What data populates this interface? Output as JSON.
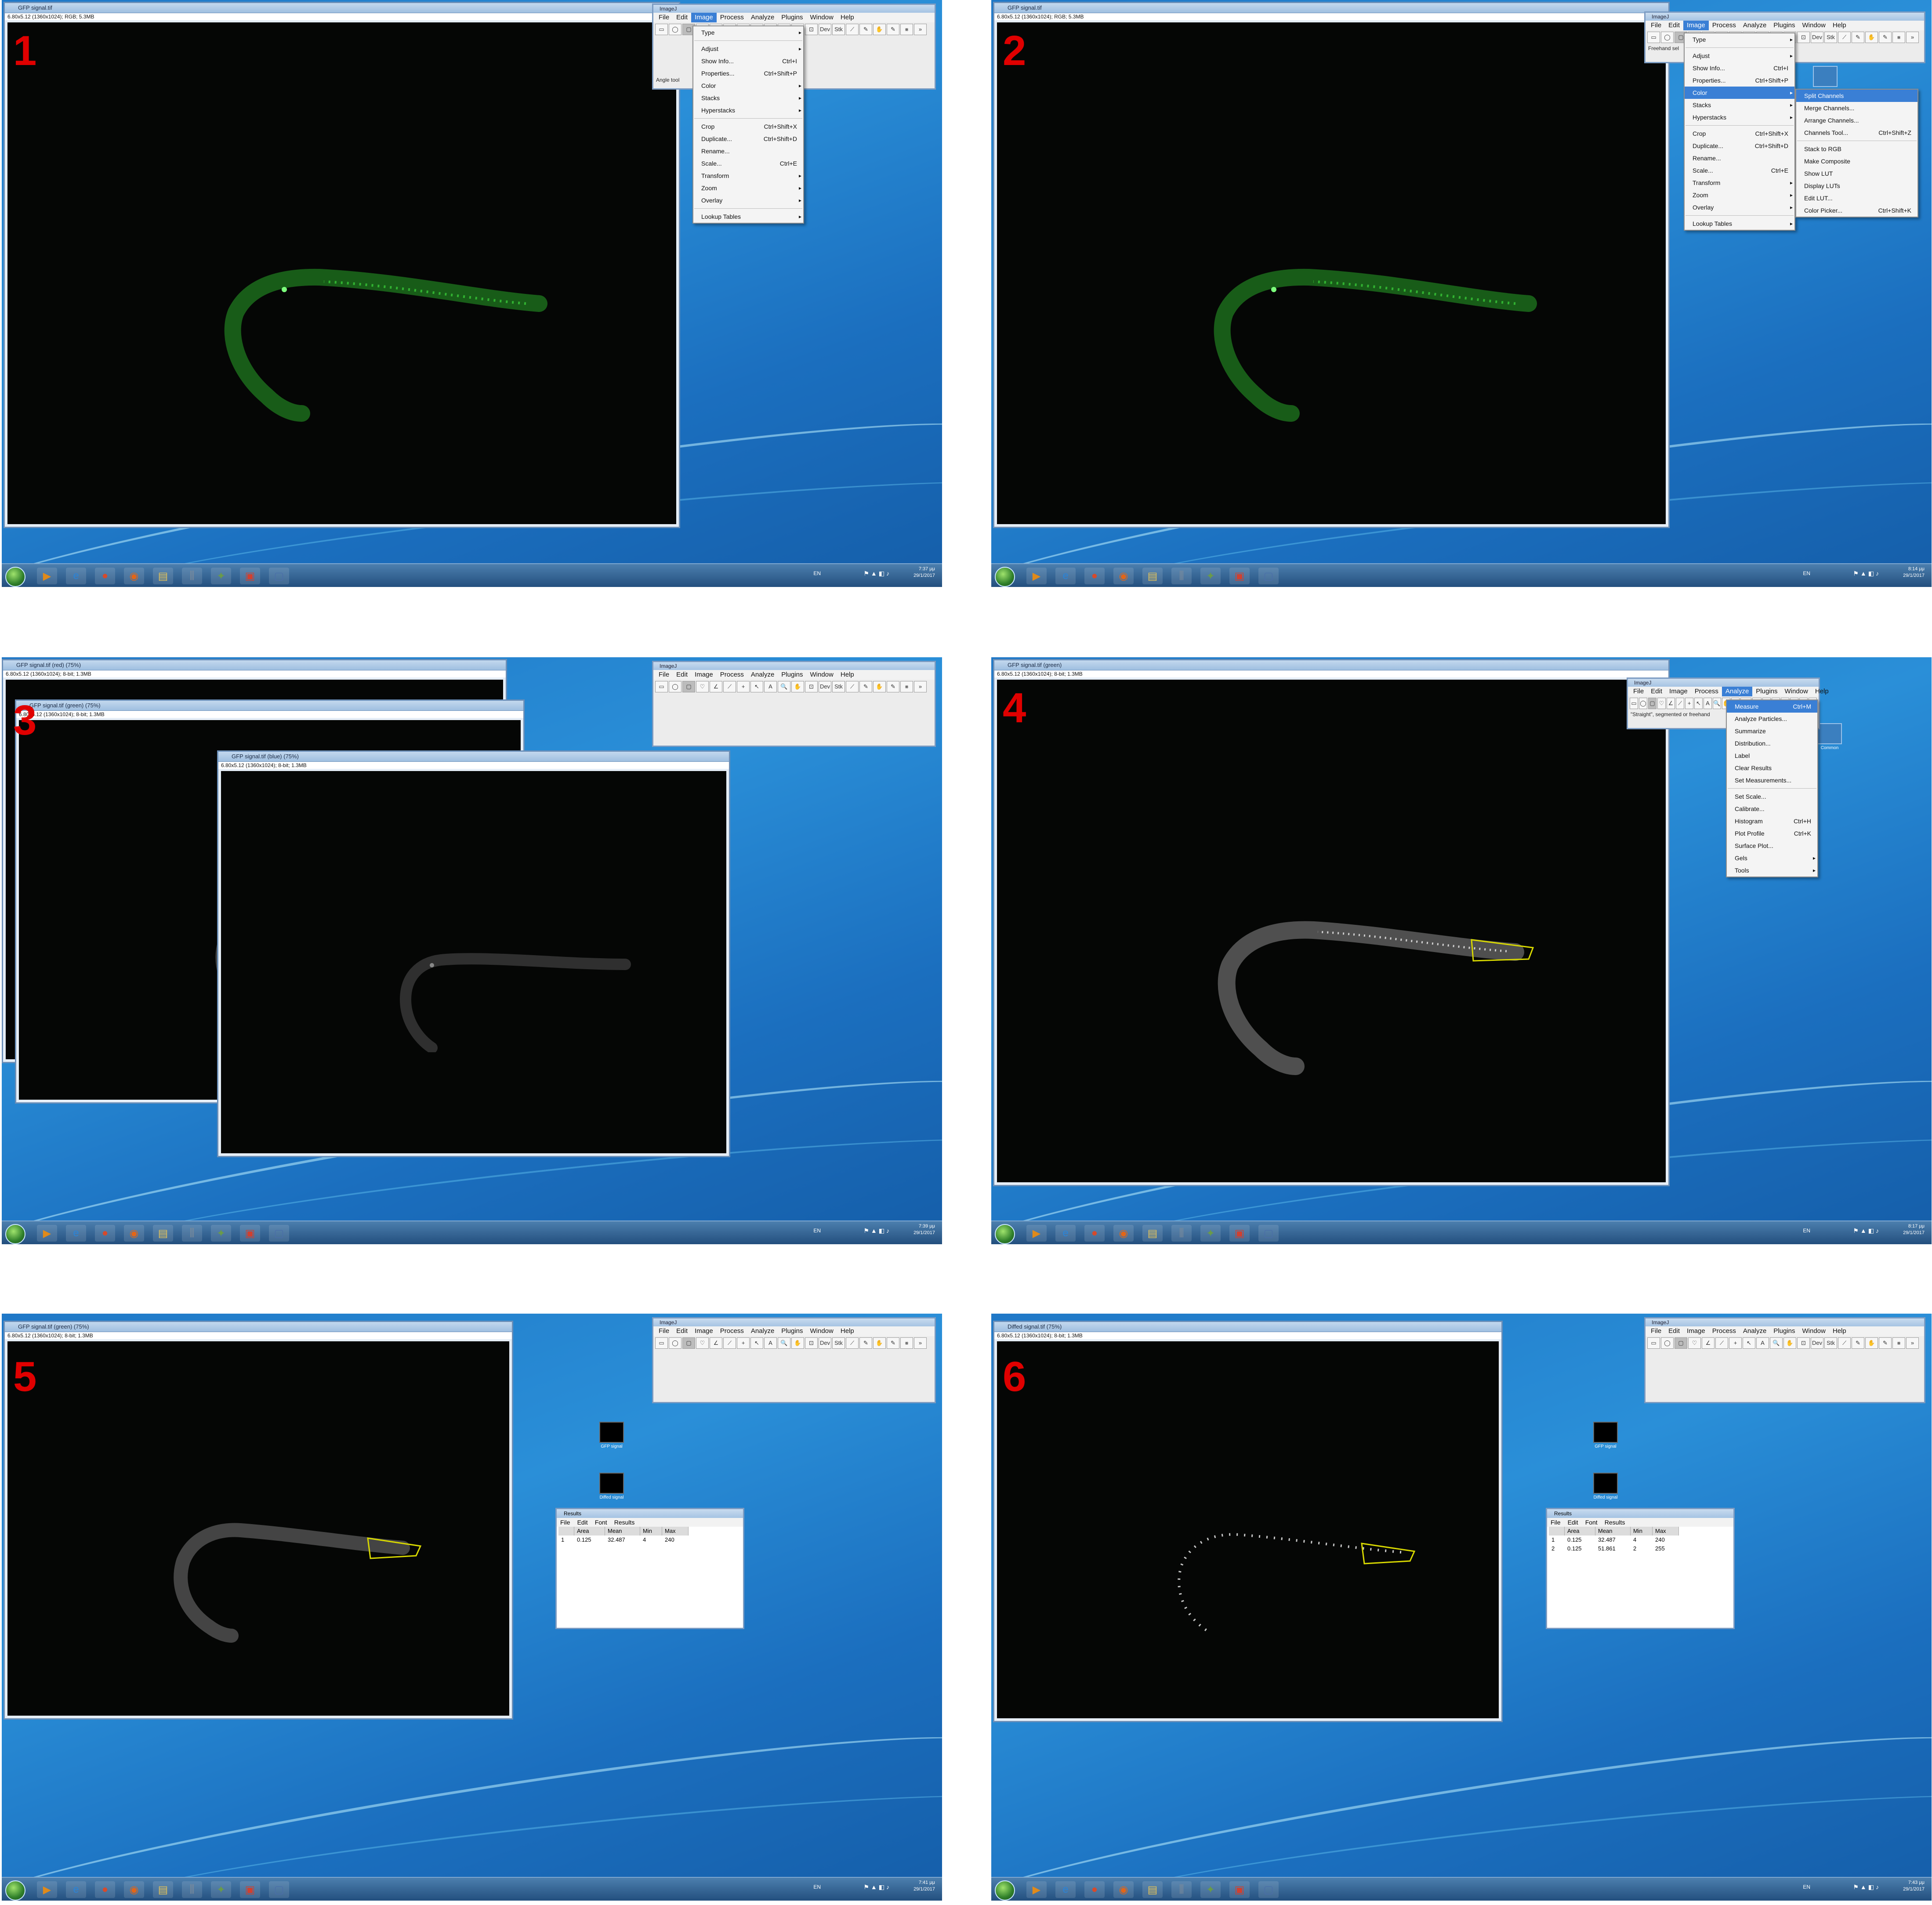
{
  "panels": [
    {
      "number": "1",
      "image_title": "GFP signal.tif",
      "image_info": "6.80x5.12  (1360x1024); RGB; 5.3MB",
      "imagej_title": "ImageJ",
      "imagej_status": "Angle tool",
      "tray_time": "7:37 μμ",
      "tray_date": "29/1/2017"
    },
    {
      "number": "2",
      "image_title": "GFP signal.tif",
      "image_info": "6.80x5.12  (1360x1024); RGB; 5.3MB",
      "imagej_title": "ImageJ",
      "imagej_status": "Freehand sel",
      "tray_time": "8:14 μμ",
      "tray_date": "29/1/2017",
      "desktop_icon": "Common"
    },
    {
      "number": "3",
      "image_title_red": "GFP signal.tif (red) (75%)",
      "image_title_green": "GFP signal.tif (green) (75%)",
      "image_title_blue": "GFP signal.tif (blue) (75%)",
      "image_info": "6.80x5.12  (1360x1024); 8-bit; 1.3MB",
      "imagej_title": "ImageJ",
      "tray_time": "7:39 μμ",
      "tray_date": "29/1/2017"
    },
    {
      "number": "4",
      "image_title": "GFP signal.tif (green)",
      "image_info": "6.80x5.12  (1360x1024); 8-bit; 1.3MB",
      "imagej_title": "ImageJ",
      "imagej_status": "\"Straight\", segmented or freehand",
      "tray_time": "8:17 μμ",
      "tray_date": "29/1/2017",
      "desktop_icon": "Common"
    },
    {
      "number": "5",
      "image_title": "GFP signal.tif (green) (75%)",
      "image_info": "6.80x5.12  (1360x1024); 8-bit; 1.3MB",
      "imagej_title": "ImageJ",
      "tray_time": "7:41 μμ",
      "tray_date": "29/1/2017",
      "icon1": "GFP signal",
      "icon2": "Diffed signal",
      "results_title": "Results"
    },
    {
      "number": "6",
      "image_title": "Diffed signal.tif (75%)",
      "image_info": "6.80x5.12  (1360x1024); 8-bit; 1.3MB",
      "imagej_title": "ImageJ",
      "tray_time": "7:43 μμ",
      "tray_date": "29/1/2017",
      "icon1": "GFP signal",
      "icon2": "Diffed signal",
      "results_title": "Results"
    }
  ],
  "imagej_menu": [
    "File",
    "Edit",
    "Image",
    "Process",
    "Analyze",
    "Plugins",
    "Window",
    "Help"
  ],
  "imagej_tools": [
    "▭",
    "◯",
    "▢",
    "♡",
    "∠",
    "⟋",
    "+",
    "↖",
    "A",
    "🔍",
    "✋",
    "⊡",
    "Dev",
    "Stk",
    "⟋",
    "✎",
    "✋",
    "✎",
    "⨳",
    "»"
  ],
  "image_menu": [
    {
      "label": "Type",
      "shortcut": "",
      "sub": true
    },
    {
      "sep": true
    },
    {
      "label": "Adjust",
      "shortcut": "",
      "sub": true
    },
    {
      "label": "Show Info...",
      "shortcut": "Ctrl+I"
    },
    {
      "label": "Properties...",
      "shortcut": "Ctrl+Shift+P"
    },
    {
      "label": "Color",
      "shortcut": "",
      "sub": true
    },
    {
      "label": "Stacks",
      "shortcut": "",
      "sub": true
    },
    {
      "label": "Hyperstacks",
      "shortcut": "",
      "sub": true
    },
    {
      "sep": true
    },
    {
      "label": "Crop",
      "shortcut": "Ctrl+Shift+X"
    },
    {
      "label": "Duplicate...",
      "shortcut": "Ctrl+Shift+D"
    },
    {
      "label": "Rename...",
      "shortcut": ""
    },
    {
      "label": "Scale...",
      "shortcut": "Ctrl+E"
    },
    {
      "label": "Transform",
      "shortcut": "",
      "sub": true
    },
    {
      "label": "Zoom",
      "shortcut": "",
      "sub": true
    },
    {
      "label": "Overlay",
      "shortcut": "",
      "sub": true
    },
    {
      "sep": true
    },
    {
      "label": "Lookup Tables",
      "shortcut": "",
      "sub": true
    }
  ],
  "color_submenu": [
    {
      "label": "Split Channels",
      "shortcut": "",
      "hl": true
    },
    {
      "label": "Merge Channels...",
      "shortcut": ""
    },
    {
      "label": "Arrange Channels...",
      "shortcut": ""
    },
    {
      "label": "Channels Tool...",
      "shortcut": "Ctrl+Shift+Z"
    },
    {
      "sep": true
    },
    {
      "label": "Stack to RGB",
      "shortcut": ""
    },
    {
      "label": "Make Composite",
      "shortcut": ""
    },
    {
      "label": "Show LUT",
      "shortcut": ""
    },
    {
      "label": "Display LUTs",
      "shortcut": ""
    },
    {
      "label": "Edit LUT...",
      "shortcut": ""
    },
    {
      "label": "Color Picker...",
      "shortcut": "Ctrl+Shift+K"
    }
  ],
  "analyze_menu": [
    {
      "label": "Measure",
      "shortcut": "Ctrl+M",
      "hl": true
    },
    {
      "label": "Analyze Particles...",
      "shortcut": ""
    },
    {
      "label": "Summarize",
      "shortcut": ""
    },
    {
      "label": "Distribution...",
      "shortcut": ""
    },
    {
      "label": "Label",
      "shortcut": ""
    },
    {
      "label": "Clear Results",
      "shortcut": ""
    },
    {
      "label": "Set Measurements...",
      "shortcut": ""
    },
    {
      "sep": true
    },
    {
      "label": "Set Scale...",
      "shortcut": ""
    },
    {
      "label": "Calibrate...",
      "shortcut": ""
    },
    {
      "label": "Histogram",
      "shortcut": "Ctrl+H"
    },
    {
      "label": "Plot Profile",
      "shortcut": "Ctrl+K"
    },
    {
      "label": "Surface Plot...",
      "shortcut": ""
    },
    {
      "label": "Gels",
      "shortcut": "",
      "sub": true
    },
    {
      "label": "Tools",
      "shortcut": "",
      "sub": true
    }
  ],
  "results_menu": [
    "File",
    "Edit",
    "Font",
    "Results"
  ],
  "results_header": [
    "",
    "Area",
    "Mean",
    "Min",
    "Max"
  ],
  "results_rows_p5": [
    [
      "1",
      "0.125",
      "32.487",
      "4",
      "240"
    ]
  ],
  "results_rows_p6": [
    [
      "1",
      "0.125",
      "32.487",
      "4",
      "240"
    ],
    [
      "2",
      "0.125",
      "51.861",
      "2",
      "255"
    ]
  ],
  "tray_lang": "EN",
  "colors": {
    "desktop": "#1f78c7",
    "taskbar": "#234f7e",
    "menu_highlight": "#3a7fd5",
    "panel_number": "#e00000",
    "roi": "#d8d800"
  }
}
